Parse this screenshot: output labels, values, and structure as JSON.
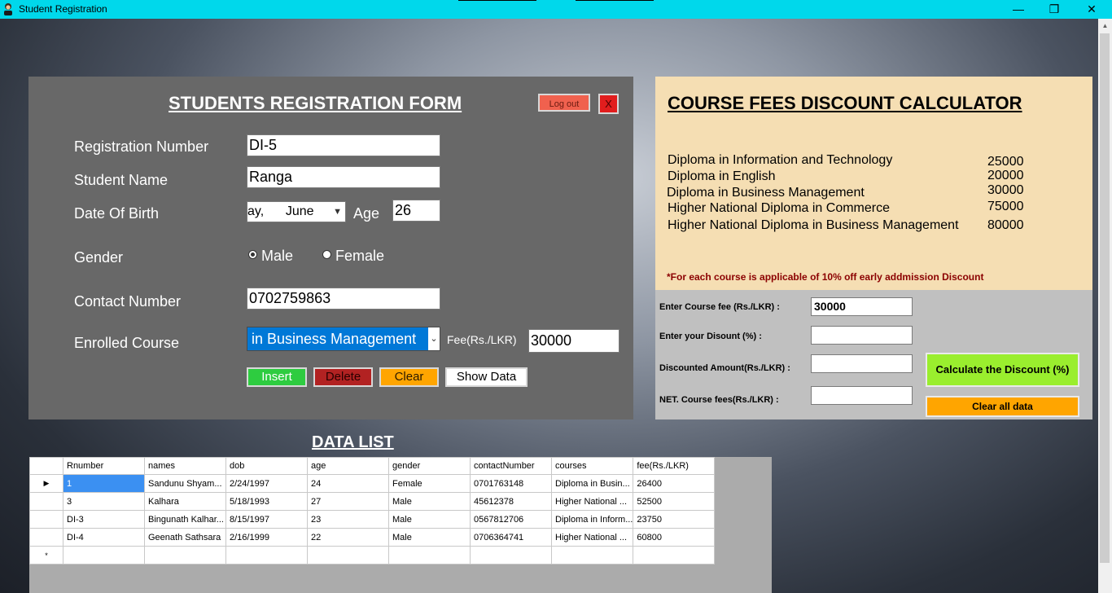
{
  "window": {
    "title": "Student Registration",
    "minimize": "—",
    "maximize": "❐",
    "close": "✕"
  },
  "form": {
    "title": "STUDENTS REGISTRATION FORM",
    "logout_label": "Log out",
    "close_label": "X",
    "labels": {
      "reg_no": "Registration Number",
      "name": "Student Name",
      "dob": "Date Of Birth",
      "age": "Age",
      "gender": "Gender",
      "contact": "Contact Number",
      "course": "Enrolled Course",
      "fee": "Fee(Rs./LKR)"
    },
    "values": {
      "reg_no": "DI-5",
      "name": "Ranga",
      "dob_display": "ay,      June",
      "age": "26",
      "contact": "0702759863",
      "course": "in Business Management",
      "fee": "30000"
    },
    "gender_options": [
      "Male",
      "Female"
    ],
    "gender_selected": "Male",
    "buttons": {
      "insert": "Insert",
      "delete": "Delete",
      "clear": "Clear",
      "show": "Show Data"
    },
    "colors": {
      "insert": "#2ecc40",
      "delete": "#b22222",
      "clear": "#ffa500",
      "show": "#ffffff"
    }
  },
  "calculator": {
    "title": "COURSE FEES DISCOUNT CALCULATOR",
    "courses": [
      {
        "name": "Diploma in Information and Technology",
        "fee": "25000"
      },
      {
        "name": "Diploma in English",
        "fee": "20000"
      },
      {
        "name": "Diploma in Business Management",
        "fee": "30000"
      },
      {
        "name": "Higher National Diploma in Commerce",
        "fee": "75000"
      },
      {
        "name": "Higher National Diploma in Business Management",
        "fee": "80000"
      }
    ],
    "note": "*For each course is applicable of 10% off early addmission Discount",
    "labels": {
      "course_fee": "Enter Course fee (Rs./LKR) :",
      "discount": "Enter your Disount (%) :",
      "discounted_amount": "Discounted Amount(Rs./LKR) :",
      "net_fee": "NET. Course fees(Rs./LKR) :"
    },
    "values": {
      "course_fee": "30000",
      "discount": "",
      "discounted_amount": "",
      "net_fee": ""
    },
    "calc_button": "Calculate the Discount (%)",
    "clear_button": "Clear all data"
  },
  "data_list": {
    "title": "DATA LIST",
    "columns": [
      "Rnumber",
      "names",
      "dob",
      "age",
      "gender",
      "contactNumber",
      "courses",
      "fee(Rs./LKR)"
    ],
    "rows": [
      [
        "1",
        "Sandunu Shyam...",
        "2/24/1997",
        "24",
        "Female",
        "0701763148",
        "Diploma in Busin...",
        "26400"
      ],
      [
        "3",
        "Kalhara",
        "5/18/1993",
        "27",
        "Male",
        "45612378",
        "Higher National ...",
        "52500"
      ],
      [
        "DI-3",
        "Bingunath Kalhar...",
        "8/15/1997",
        "23",
        "Male",
        "0567812706",
        "Diploma in Inform...",
        "23750"
      ],
      [
        "DI-4",
        "Geenath Sathsara",
        "2/16/1999",
        "22",
        "Male",
        "0706364741",
        "Higher National ...",
        "60800"
      ]
    ],
    "current_row_marker": "▶",
    "new_row_marker": "*"
  }
}
